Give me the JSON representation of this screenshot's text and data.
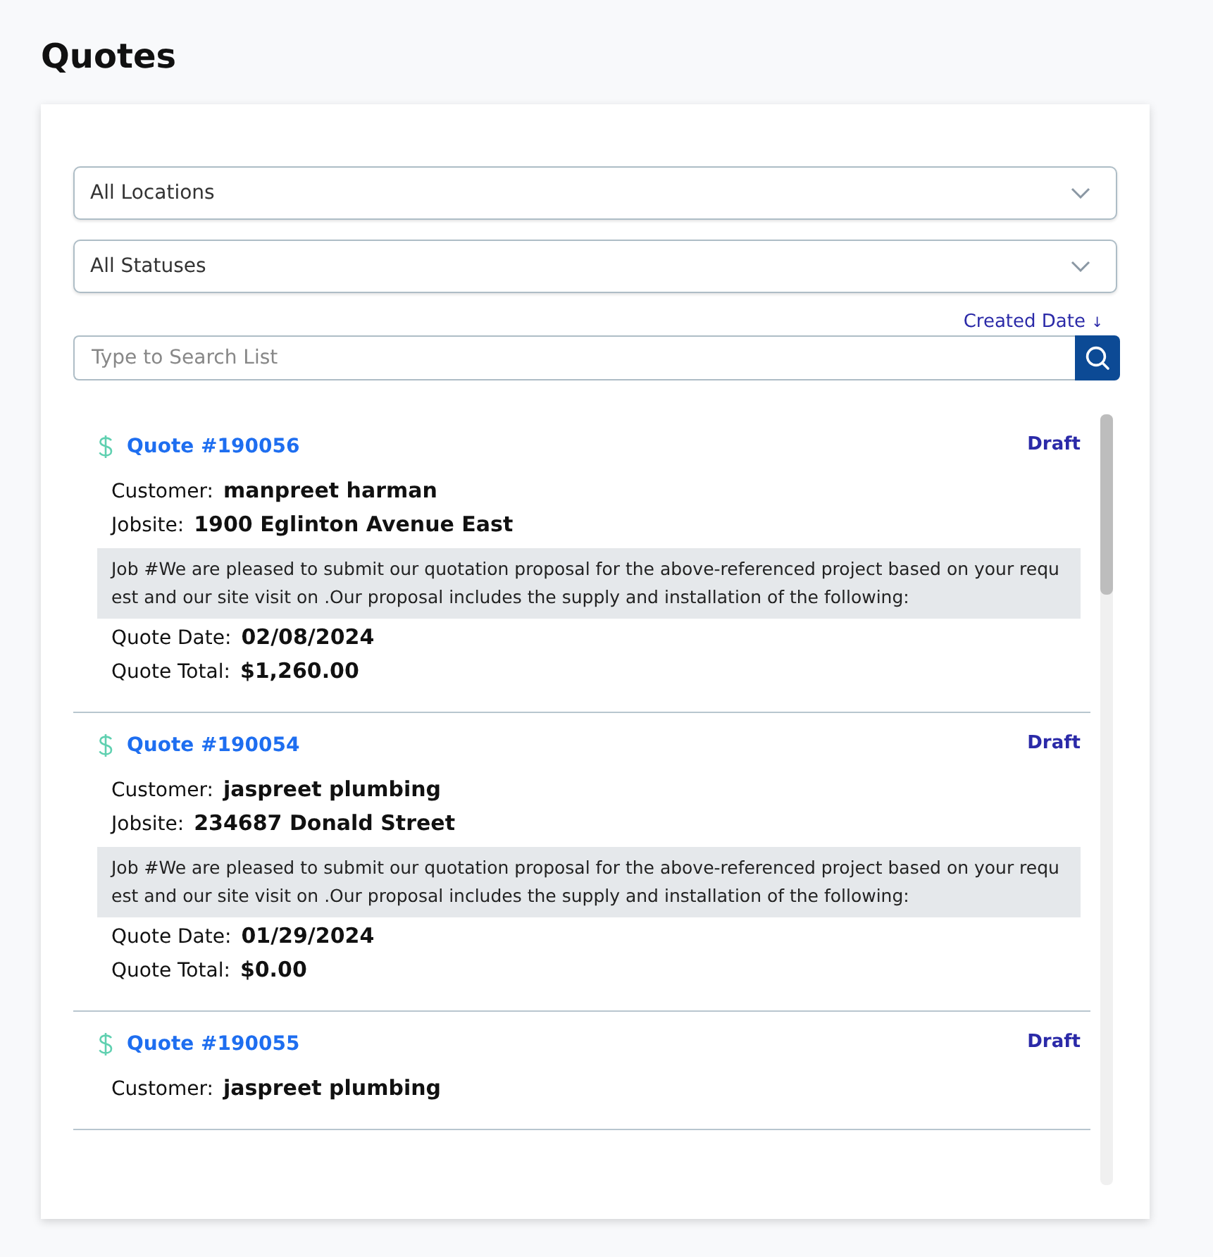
{
  "title": "Quotes",
  "filters": [
    {
      "value": "All Locations"
    },
    {
      "value": "All Statuses"
    }
  ],
  "sort": {
    "label": "Created Date",
    "arrow": "↓"
  },
  "search": {
    "placeholder": "Type to Search List"
  },
  "quotes": [
    {
      "number": "Quote #190056",
      "status": "Draft",
      "fields": [
        {
          "label": "Customer:",
          "value": "manpreet harman"
        },
        {
          "label": "Jobsite:",
          "value": "1900 Eglinton Avenue East"
        }
      ],
      "description": "Job #We are pleased to submit our quotation proposal for the above-referenced project based on your request and our site visit on .Our proposal includes the supply and installation of the following:",
      "totals": [
        {
          "label": "Quote Date:",
          "value": "02/08/2024"
        },
        {
          "label": "Quote Total:",
          "value": "$1,260.00"
        }
      ]
    },
    {
      "number": "Quote #190054",
      "status": "Draft",
      "fields": [
        {
          "label": "Customer:",
          "value": "jaspreet plumbing"
        },
        {
          "label": "Jobsite:",
          "value": "234687 Donald Street"
        }
      ],
      "description": "Job #We are pleased to submit our quotation proposal for the above-referenced project based on your request and our site visit on .Our proposal includes the supply and installation of the following:",
      "totals": [
        {
          "label": "Quote Date:",
          "value": "01/29/2024"
        },
        {
          "label": "Quote Total:",
          "value": "$0.00"
        }
      ]
    },
    {
      "number": "Quote #190055",
      "status": "Draft",
      "fields": [
        {
          "label": "Customer:",
          "value": "jaspreet plumbing"
        }
      ]
    }
  ]
}
